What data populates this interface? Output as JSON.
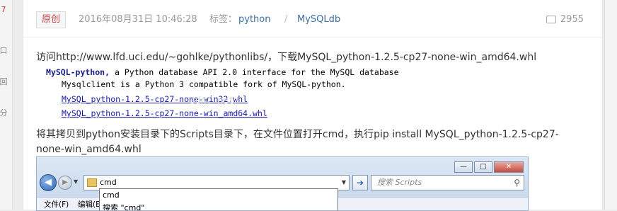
{
  "left_toolbar": {
    "items": [
      "7",
      "口",
      "回",
      "分"
    ]
  },
  "article": {
    "badge": "原创",
    "date": "2016年08月31日 10:46:28",
    "tags_label": "标签：",
    "tags": [
      "python",
      "MySQLdb"
    ],
    "tag_separator": "/",
    "view_count": "2955",
    "paragraph1": "访问http://www.lfd.uci.edu/~gohlke/pythonlibs/，下载MySQL_python-1.2.5-cp27-none-win_amd64.whl",
    "paragraph2": "将其拷贝到python安装目录下的Scripts目录下，在文件位置打开cmd，执行pip install MySQL_python-1.2.5-cp27-none-win_amd64.whl"
  },
  "code_image": {
    "line1_bold": "MySQL-python,",
    "line1_rest": " a Python database API 2.0 interface for the MySQL database",
    "line2": "Mysqlclient is a Python 3 compatible fork of MySQL-python.",
    "link1": "MySQL_python-1.2.5-cp27-none-win32.whl",
    "link2": "MySQL_python-1.2.5-cp27-none-win_amd64.whl",
    "watermark": "sdn. net/"
  },
  "explorer": {
    "address_value": "cmd",
    "search_placeholder": "搜索 Scripts",
    "autocomplete": [
      "cmd",
      "搜索 \"cmd\""
    ],
    "menu": [
      "文件(F)",
      "编辑(E)"
    ],
    "window_buttons": [
      "—",
      "□",
      "✕"
    ]
  }
}
